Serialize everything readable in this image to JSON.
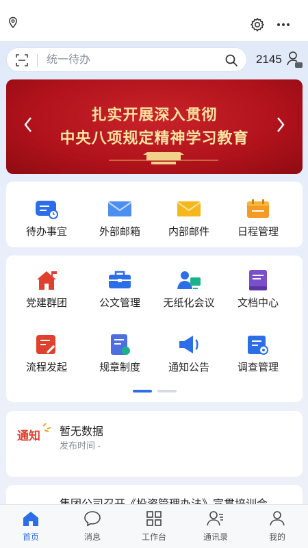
{
  "header": {
    "location_icon": "location-pin-icon",
    "settings_icon": "gear-icon",
    "more_icon": "more-dots-icon"
  },
  "search": {
    "placeholder": "统一待办",
    "scan_icon": "scan-icon",
    "search_icon": "magnifier-icon"
  },
  "badge": {
    "count": "2145",
    "user_icon": "user-status-icon"
  },
  "banner": {
    "line1": "扎实开展深入贯彻",
    "line2": "中央八项规定精神学习教育",
    "colors": {
      "background": "#b0121b",
      "text": "#fbe3a1"
    }
  },
  "quick_actions": [
    {
      "label": "待办事宜",
      "icon": "todo-icon"
    },
    {
      "label": "外部邮箱",
      "icon": "mail-blue-icon"
    },
    {
      "label": "内部邮件",
      "icon": "mail-yellow-icon"
    },
    {
      "label": "日程管理",
      "icon": "calendar-icon"
    }
  ],
  "apps": [
    {
      "label": "党建群团",
      "icon": "party-home-icon"
    },
    {
      "label": "公文管理",
      "icon": "briefcase-icon"
    },
    {
      "label": "无纸化会议",
      "icon": "meeting-icon"
    },
    {
      "label": "文档中心",
      "icon": "book-icon"
    },
    {
      "label": "流程发起",
      "icon": "process-icon"
    },
    {
      "label": "规章制度",
      "icon": "rules-icon"
    },
    {
      "label": "通知公告",
      "icon": "megaphone-icon"
    },
    {
      "label": "调查管理",
      "icon": "survey-icon"
    }
  ],
  "pager": {
    "active_page": 1,
    "total_pages": 2
  },
  "notice": {
    "badge_text": "通知",
    "title": "暂无数据",
    "sub": "发布时间   -"
  },
  "news": {
    "text": "集团公司召开《投资管理办法》宣贯培训会"
  },
  "tabbar": [
    {
      "label": "首页",
      "icon": "home-icon",
      "active": true
    },
    {
      "label": "消息",
      "icon": "message-icon",
      "active": false
    },
    {
      "label": "工作台",
      "icon": "grid-icon",
      "active": false
    },
    {
      "label": "通讯录",
      "icon": "contacts-icon",
      "active": false
    },
    {
      "label": "我的",
      "icon": "profile-icon",
      "active": false
    }
  ],
  "colors": {
    "accent": "#2b6ee8",
    "notice_red": "#e0412f"
  }
}
